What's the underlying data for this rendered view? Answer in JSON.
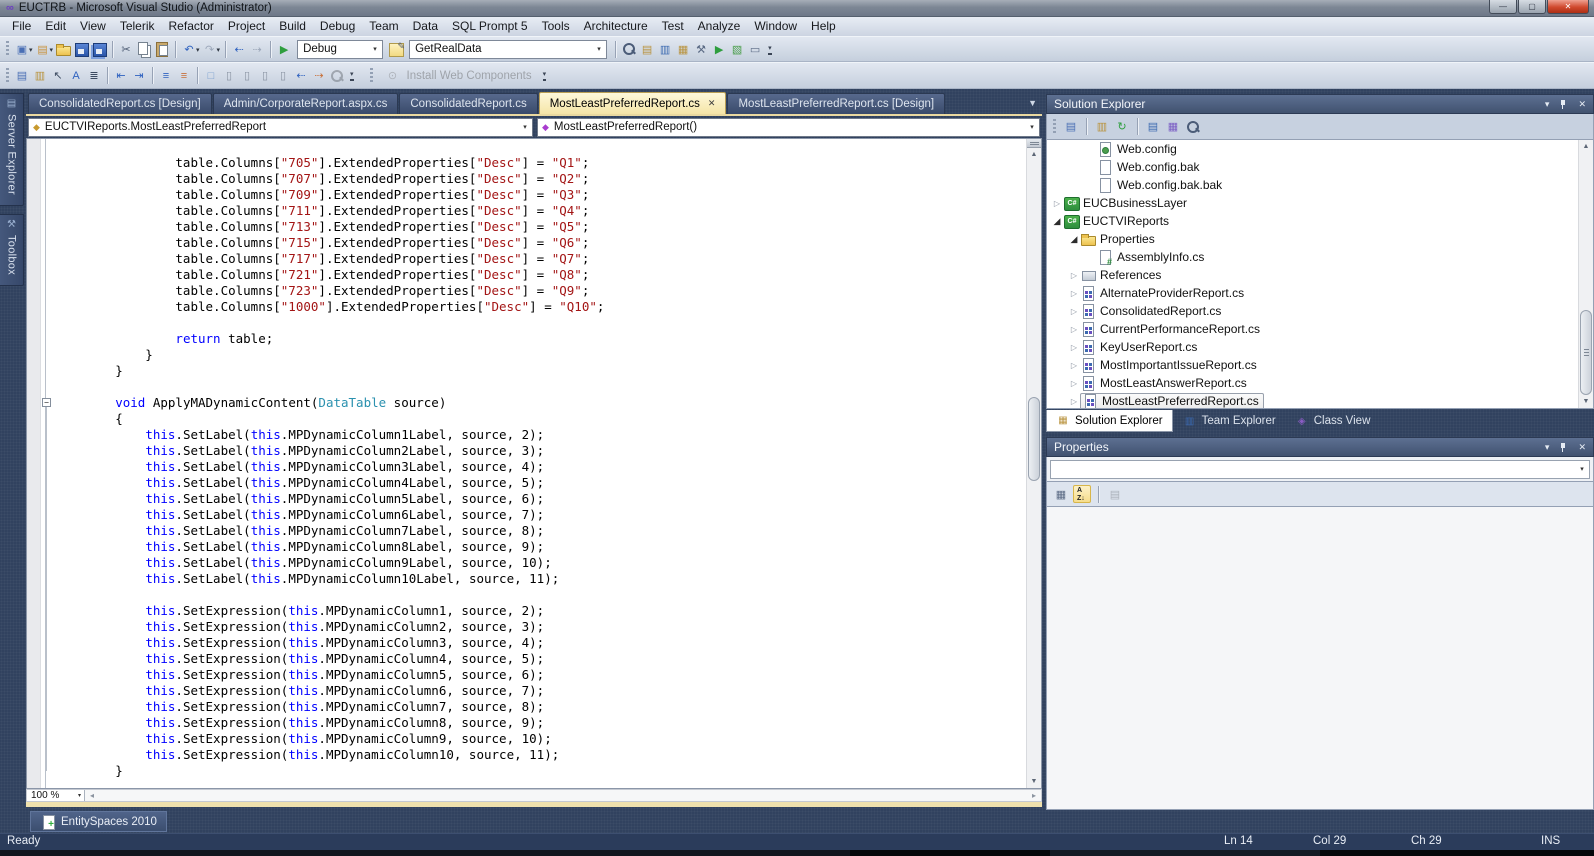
{
  "window": {
    "title": "EUCTRB - Microsoft Visual Studio (Administrator)"
  },
  "menu": {
    "items": [
      "File",
      "Edit",
      "View",
      "Telerik",
      "Refactor",
      "Project",
      "Build",
      "Debug",
      "Team",
      "Data",
      "SQL Prompt 5",
      "Tools",
      "Architecture",
      "Test",
      "Analyze",
      "Window",
      "Help"
    ]
  },
  "toolbar1": {
    "items": [
      {
        "k": "ico",
        "n": "new-project-icon",
        "g": "▣",
        "col": "#4a6fb5",
        "dd": true
      },
      {
        "k": "ico",
        "n": "add-new-item-icon",
        "g": "▤",
        "col": "#c8923c",
        "dd": true
      },
      {
        "k": "ico",
        "n": "open-file-icon",
        "c": "sh-folder"
      },
      {
        "k": "ico",
        "n": "save-icon",
        "c": "sh-floppy"
      },
      {
        "k": "ico",
        "n": "save-all-icon",
        "c": "sh-floppy2"
      },
      {
        "k": "sep"
      },
      {
        "k": "ico",
        "n": "cut-icon",
        "g": "✂",
        "col": "#47566e"
      },
      {
        "k": "ico",
        "n": "copy-icon",
        "c": "sh-copy"
      },
      {
        "k": "ico",
        "n": "paste-icon",
        "c": "sh-paste"
      },
      {
        "k": "sep"
      },
      {
        "k": "ico",
        "n": "undo-icon",
        "g": "↶",
        "col": "#2f62c0",
        "dd": true
      },
      {
        "k": "ico",
        "n": "redo-icon",
        "g": "↷",
        "col": "#2f62c0",
        "dd": true,
        "dis": true
      },
      {
        "k": "sep"
      },
      {
        "k": "ico",
        "n": "navigate-backward-icon",
        "g": "⇠",
        "col": "#2f62c0"
      },
      {
        "k": "ico",
        "n": "navigate-forward-icon",
        "g": "⇢",
        "col": "#2f62c0",
        "dis": true
      },
      {
        "k": "sep"
      },
      {
        "k": "ico",
        "n": "start-debugging-icon",
        "g": "▶",
        "col": "#2e9e3e"
      },
      {
        "k": "combo",
        "n": "solution-configurations-combo",
        "v": "Debug",
        "w": 86
      },
      {
        "k": "ico",
        "n": "find-edit-icon",
        "c": "sh-findbox"
      },
      {
        "k": "combo",
        "n": "find-combo",
        "v": "GetRealData",
        "w": 198
      },
      {
        "k": "sep"
      },
      {
        "k": "ico",
        "n": "find-in-files-icon",
        "c": "sh-mag"
      },
      {
        "k": "ico",
        "n": "properties-window-icon",
        "g": "▤",
        "col": "#b8923c"
      },
      {
        "k": "ico",
        "n": "object-browser-icon",
        "g": "▥",
        "col": "#3c6ab0"
      },
      {
        "k": "ico",
        "n": "solution-explorer-window-icon",
        "g": "▦",
        "col": "#b8923c"
      },
      {
        "k": "ico",
        "n": "tools-options-icon",
        "g": "⚒",
        "col": "#5a6a84"
      },
      {
        "k": "ico",
        "n": "command-window-icon",
        "g": "▶",
        "col": "#2e9e3e"
      },
      {
        "k": "ico",
        "n": "start-page-icon",
        "g": "▧",
        "col": "#4a9e4a"
      },
      {
        "k": "ico",
        "n": "immediate-window-icon",
        "g": "▭",
        "col": "#5a6a84"
      },
      {
        "k": "ovf"
      }
    ]
  },
  "toolbar2": {
    "items": [
      {
        "k": "ico",
        "n": "format-document-icon",
        "g": "▤",
        "col": "#4a6fb5"
      },
      {
        "k": "ico",
        "n": "view-in-browser-icon",
        "g": "▥",
        "col": "#b8923c"
      },
      {
        "k": "ico",
        "n": "select-element-icon",
        "g": "↖",
        "col": "#3c4a60"
      },
      {
        "k": "ico",
        "n": "edit-style-icon",
        "g": "A",
        "col": "#2f62c0"
      },
      {
        "k": "ico",
        "n": "document-outline-icon",
        "g": "≣",
        "col": "#3c4a60"
      },
      {
        "k": "sep"
      },
      {
        "k": "ico",
        "n": "decrease-indent-icon",
        "g": "⇤",
        "col": "#2f62c0"
      },
      {
        "k": "ico",
        "n": "increase-indent-icon",
        "g": "⇥",
        "col": "#2f62c0"
      },
      {
        "k": "sep"
      },
      {
        "k": "ico",
        "n": "bullets-icon",
        "g": "≡",
        "col": "#2f62c0"
      },
      {
        "k": "ico",
        "n": "numbering-icon",
        "g": "≡",
        "col": "#c8713c"
      },
      {
        "k": "sep"
      },
      {
        "k": "ico",
        "n": "whitespace-icon",
        "g": "□",
        "col": "#7a9ecf"
      },
      {
        "k": "ico",
        "n": "new-comment-icon",
        "g": "▯",
        "col": "#8a93a2"
      },
      {
        "k": "ico",
        "n": "previous-comment-icon",
        "g": "▯",
        "col": "#8a93a2"
      },
      {
        "k": "ico",
        "n": "next-comment-icon",
        "g": "▯",
        "col": "#8a93a2"
      },
      {
        "k": "ico",
        "n": "delete-comment-icon",
        "g": "▯",
        "col": "#8a93a2"
      },
      {
        "k": "ico",
        "n": "navigate-back-document-icon",
        "g": "⇠",
        "col": "#2f62c0"
      },
      {
        "k": "ico",
        "n": "navigate-forward-document-icon",
        "g": "⇢",
        "col": "#c8713c"
      },
      {
        "k": "ico",
        "n": "find-symbol-result-icon",
        "c": "sh-mag",
        "dis": true
      },
      {
        "k": "ovf"
      },
      {
        "k": "gap"
      },
      {
        "k": "btn",
        "n": "install-web-components-button",
        "v": "Install Web Components",
        "g": "⊙",
        "col": "#8a93a2",
        "dis": true
      },
      {
        "k": "ovf"
      }
    ]
  },
  "left_dock": {
    "tabs": [
      {
        "label": "Server Explorer",
        "icon": "server-explorer-icon",
        "g": "▤",
        "col": "#9ab0d0"
      },
      {
        "label": "Toolbox",
        "icon": "toolbox-icon",
        "g": "⚒",
        "col": "#9ab0d0"
      }
    ]
  },
  "document_tabs": [
    {
      "label": "ConsolidatedReport.cs [Design]",
      "active": false
    },
    {
      "label": "Admin/CorporateReport.aspx.cs",
      "active": false
    },
    {
      "label": "ConsolidatedReport.cs",
      "active": false
    },
    {
      "label": "MostLeastPreferredReport.cs",
      "active": true,
      "close_glyph": "✕"
    },
    {
      "label": "MostLeastPreferredReport.cs [Design]",
      "active": false
    }
  ],
  "navigation_bar": {
    "type_combo": "EUCTVIReports.MostLeastPreferredReport",
    "member_combo": "MostLeastPreferredReport()"
  },
  "editor": {
    "zoom_level": "100 %",
    "code_lines": [
      "                table.Columns[\"705\"].ExtendedProperties[\"Desc\"] = \"Q1\";",
      "                table.Columns[\"707\"].ExtendedProperties[\"Desc\"] = \"Q2\";",
      "                table.Columns[\"709\"].ExtendedProperties[\"Desc\"] = \"Q3\";",
      "                table.Columns[\"711\"].ExtendedProperties[\"Desc\"] = \"Q4\";",
      "                table.Columns[\"713\"].ExtendedProperties[\"Desc\"] = \"Q5\";",
      "                table.Columns[\"715\"].ExtendedProperties[\"Desc\"] = \"Q6\";",
      "                table.Columns[\"717\"].ExtendedProperties[\"Desc\"] = \"Q7\";",
      "                table.Columns[\"721\"].ExtendedProperties[\"Desc\"] = \"Q8\";",
      "                table.Columns[\"723\"].ExtendedProperties[\"Desc\"] = \"Q9\";",
      "                table.Columns[\"1000\"].ExtendedProperties[\"Desc\"] = \"Q10\";",
      "",
      "                return table;",
      "            }",
      "        }",
      "",
      "        void ApplyMADynamicContent(DataTable source)",
      "        {",
      "            this.SetLabel(this.MPDynamicColumn1Label, source, 2);",
      "            this.SetLabel(this.MPDynamicColumn2Label, source, 3);",
      "            this.SetLabel(this.MPDynamicColumn3Label, source, 4);",
      "            this.SetLabel(this.MPDynamicColumn4Label, source, 5);",
      "            this.SetLabel(this.MPDynamicColumn5Label, source, 6);",
      "            this.SetLabel(this.MPDynamicColumn6Label, source, 7);",
      "            this.SetLabel(this.MPDynamicColumn7Label, source, 8);",
      "            this.SetLabel(this.MPDynamicColumn8Label, source, 9);",
      "            this.SetLabel(this.MPDynamicColumn9Label, source, 10);",
      "            this.SetLabel(this.MPDynamicColumn10Label, source, 11);",
      "",
      "            this.SetExpression(this.MPDynamicColumn1, source, 2);",
      "            this.SetExpression(this.MPDynamicColumn2, source, 3);",
      "            this.SetExpression(this.MPDynamicColumn3, source, 4);",
      "            this.SetExpression(this.MPDynamicColumn4, source, 5);",
      "            this.SetExpression(this.MPDynamicColumn5, source, 6);",
      "            this.SetExpression(this.MPDynamicColumn6, source, 7);",
      "            this.SetExpression(this.MPDynamicColumn7, source, 8);",
      "            this.SetExpression(this.MPDynamicColumn8, source, 9);",
      "            this.SetExpression(this.MPDynamicColumn9, source, 10);",
      "            this.SetExpression(this.MPDynamicColumn10, source, 11);",
      "        }"
    ]
  },
  "solution_explorer": {
    "title": "Solution Explorer",
    "toolbar": [
      {
        "k": "ico",
        "n": "properties-icon",
        "g": "▤",
        "col": "#4a6fb5"
      },
      {
        "k": "sep"
      },
      {
        "k": "ico",
        "n": "show-all-files-icon",
        "g": "▥",
        "col": "#b8923c"
      },
      {
        "k": "ico",
        "n": "refresh-icon",
        "g": "↻",
        "col": "#2e9e3e"
      },
      {
        "k": "sep"
      },
      {
        "k": "ico",
        "n": "view-code-icon",
        "g": "▤",
        "col": "#3c6ab0"
      },
      {
        "k": "ico",
        "n": "view-designer-icon",
        "g": "▦",
        "col": "#7a5cc4"
      },
      {
        "k": "ico",
        "n": "view-class-diagram-icon",
        "c": "sh-mag"
      }
    ],
    "tree": [
      {
        "label": "Web.config",
        "icon": "config-file-icon",
        "level": 2,
        "exp": ""
      },
      {
        "label": "Web.config.bak",
        "icon": "file-icon",
        "level": 2,
        "exp": ""
      },
      {
        "label": "Web.config.bak.bak",
        "icon": "file-icon",
        "level": 2,
        "exp": ""
      },
      {
        "label": "EUCBusinessLayer",
        "icon": "csharp-project-icon",
        "level": 0,
        "exp": "collapsed"
      },
      {
        "label": "EUCTVIReports",
        "icon": "csharp-project-icon",
        "level": 0,
        "exp": "expanded"
      },
      {
        "label": "Properties",
        "icon": "folder-icon",
        "level": 1,
        "exp": "expanded"
      },
      {
        "label": "AssemblyInfo.cs",
        "icon": "csharp-file-icon",
        "level": 2,
        "exp": ""
      },
      {
        "label": "References",
        "icon": "references-icon",
        "level": 1,
        "exp": "collapsed"
      },
      {
        "label": "AlternateProviderReport.cs",
        "icon": "component-file-icon",
        "level": 1,
        "exp": "collapsed"
      },
      {
        "label": "ConsolidatedReport.cs",
        "icon": "component-file-icon",
        "level": 1,
        "exp": "collapsed"
      },
      {
        "label": "CurrentPerformanceReport.cs",
        "icon": "component-file-icon",
        "level": 1,
        "exp": "collapsed"
      },
      {
        "label": "KeyUserReport.cs",
        "icon": "component-file-icon",
        "level": 1,
        "exp": "collapsed"
      },
      {
        "label": "MostImportantIssueReport.cs",
        "icon": "component-file-icon",
        "level": 1,
        "exp": "collapsed"
      },
      {
        "label": "MostLeastAnswerReport.cs",
        "icon": "component-file-icon",
        "level": 1,
        "exp": "collapsed"
      },
      {
        "label": "MostLeastPreferredReport.cs",
        "icon": "component-file-icon",
        "level": 1,
        "exp": "collapsed",
        "selected": true
      }
    ],
    "tabs": [
      {
        "label": "Solution Explorer",
        "icon": "solution-explorer-tab-icon",
        "g": "▦",
        "col": "#b8923c",
        "active": true
      },
      {
        "label": "Team Explorer",
        "icon": "team-explorer-tab-icon",
        "g": "▥",
        "col": "#3c6ab0",
        "active": false
      },
      {
        "label": "Class View",
        "icon": "class-view-tab-icon",
        "g": "◈",
        "col": "#8a5cc4",
        "active": false
      }
    ]
  },
  "properties_panel": {
    "title": "Properties"
  },
  "bottom_dock": {
    "tab_label": "EntitySpaces 2010"
  },
  "status_bar": {
    "ready": "Ready",
    "line": "Ln 14",
    "column": "Col 29",
    "character": "Ch 29",
    "mode": "INS"
  }
}
